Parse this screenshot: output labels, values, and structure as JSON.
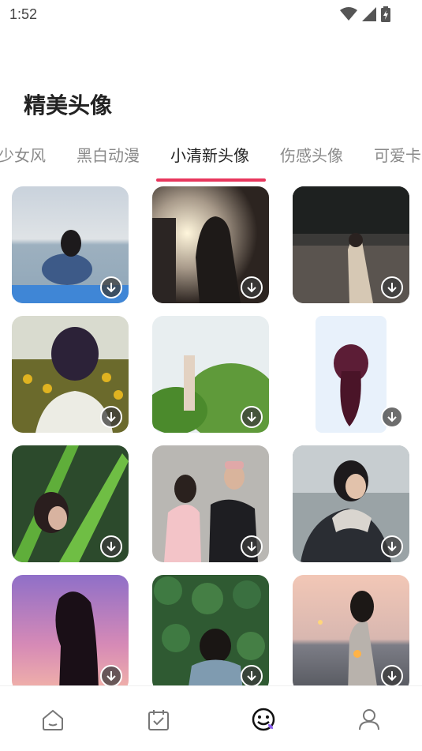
{
  "status": {
    "time": "1:52"
  },
  "page": {
    "title": "精美头像"
  },
  "tabs": [
    {
      "label": "少女风"
    },
    {
      "label": "黑白动漫"
    },
    {
      "label": "小清新头像",
      "active": true
    },
    {
      "label": "伤感头像"
    },
    {
      "label": "可爱卡"
    }
  ],
  "colors": {
    "accent": "#e8365d",
    "text": "#222222",
    "muted": "#8a8a8a"
  },
  "grid": {
    "items": [
      {
        "icon": "download-icon"
      },
      {
        "icon": "download-icon"
      },
      {
        "icon": "download-icon"
      },
      {
        "icon": "download-icon"
      },
      {
        "icon": "download-icon"
      },
      {
        "icon": "download-icon"
      },
      {
        "icon": "download-icon"
      },
      {
        "icon": "download-icon"
      },
      {
        "icon": "download-icon"
      },
      {
        "icon": "download-icon"
      },
      {
        "icon": "download-icon"
      },
      {
        "icon": "download-icon"
      }
    ]
  },
  "bottom_nav": {
    "items": [
      {
        "icon": "home-icon"
      },
      {
        "icon": "calendar-check-icon"
      },
      {
        "icon": "smiley-icon",
        "active": true
      },
      {
        "icon": "user-icon"
      }
    ]
  }
}
